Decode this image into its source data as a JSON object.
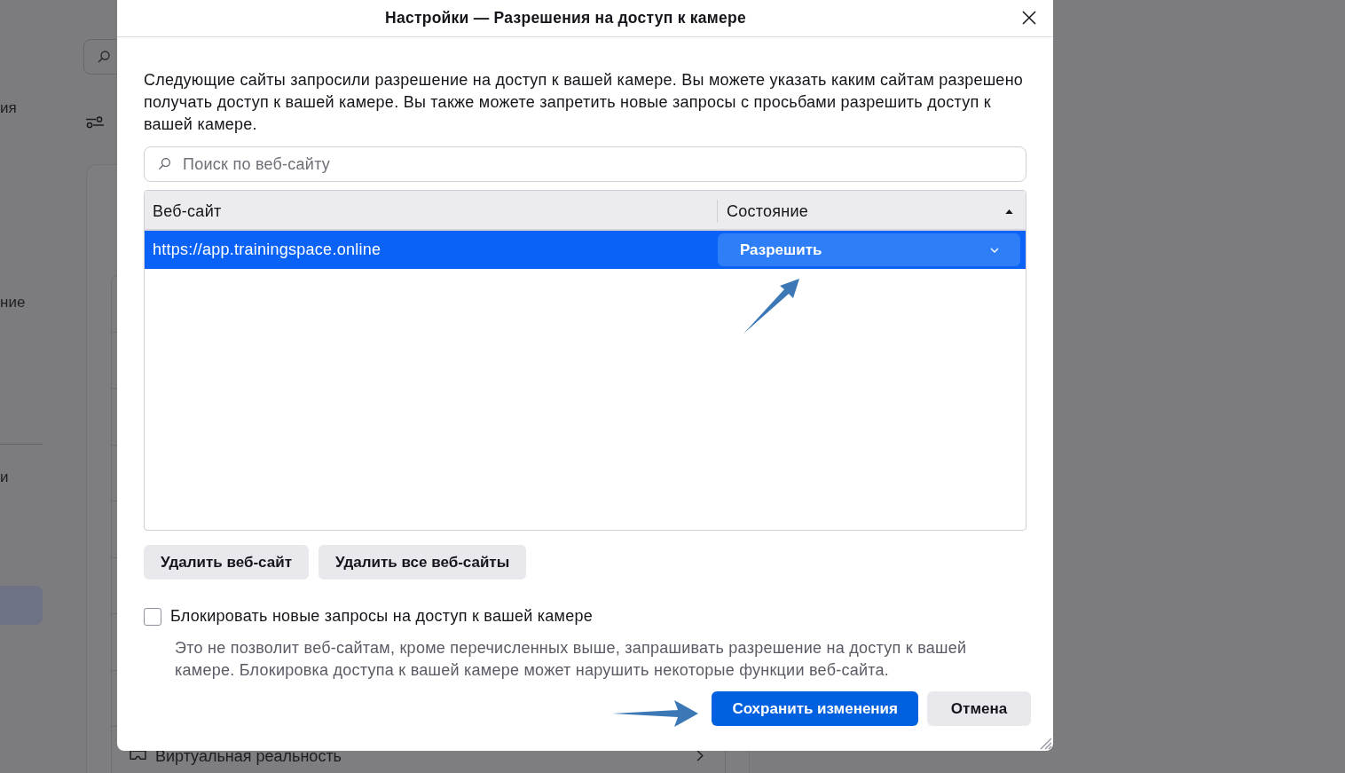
{
  "background_page": {
    "sidebar": {
      "items": [
        {
          "label": "ия",
          "selected": false
        },
        {
          "label": "ние",
          "selected": false
        }
      ],
      "footer_items": [
        {
          "label": "и",
          "selected": false
        },
        {
          "selected": true
        }
      ]
    },
    "settings_rows": [
      {
        "label": "Виртуальная реальность"
      }
    ]
  },
  "dialog": {
    "title": "Настройки — Разрешения на доступ к камере",
    "description": "Следующие сайты запросили разрешение на доступ к вашей камере. Вы можете указать каким сайтам разрешено получать доступ к вашей камере. Вы также можете запретить новые запросы с просьбами разрешить доступ к вашей камере.",
    "search": {
      "placeholder": "Поиск по веб-сайту"
    },
    "table": {
      "columns": [
        {
          "label": "Веб-сайт",
          "sorted": false
        },
        {
          "label": "Состояние",
          "sorted": true
        }
      ],
      "rows": [
        {
          "website": "https://app.trainingspace.online",
          "status": "Разрешить",
          "selected": true
        }
      ]
    },
    "remove_buttons": [
      {
        "label": "Удалить веб-сайт"
      },
      {
        "label": "Удалить все веб-сайты"
      }
    ],
    "block_checkbox": {
      "label": "Блокировать новые запросы на доступ к вашей камере",
      "checked": false,
      "hint": "Это не позволит веб-сайтам, кроме перечисленных выше, запрашивать разрешение на доступ к вашей камере. Блокировка доступа к вашей камере может нарушить некоторые функции веб-сайта."
    },
    "footer_buttons": [
      {
        "label": "Сохранить изменения",
        "kind": "primary"
      },
      {
        "label": "Отмена",
        "kind": "secondary"
      }
    ]
  }
}
